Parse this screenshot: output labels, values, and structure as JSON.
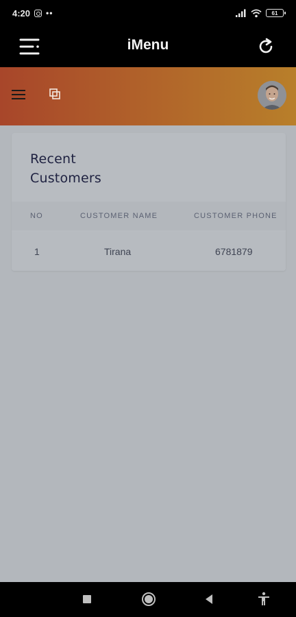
{
  "status_bar": {
    "time": "4:20",
    "dots": "••",
    "battery": "61"
  },
  "app_bar": {
    "title": "iMenu"
  },
  "recent_customers": {
    "title": "Recent Customers",
    "columns": [
      "NO",
      "CUSTOMER NAME",
      "CUSTOMER PHONE"
    ],
    "rows": [
      {
        "no": "1",
        "name": "Tirana",
        "phone": "6781879"
      }
    ]
  },
  "colors": {
    "header_gradient_start": "#a8462a",
    "header_gradient_end": "#b87f2a",
    "background": "#b3b7bc",
    "title_text": "#1e2140"
  },
  "icons": {
    "menu": "menu-lines-icon",
    "refresh": "refresh-icon",
    "hamburger": "hamburger-icon",
    "windows": "windows-icon",
    "avatar": "user-avatar",
    "nav_recent": "square-icon",
    "nav_home": "circle-icon",
    "nav_back": "triangle-back-icon",
    "nav_accessibility": "accessibility-icon"
  }
}
